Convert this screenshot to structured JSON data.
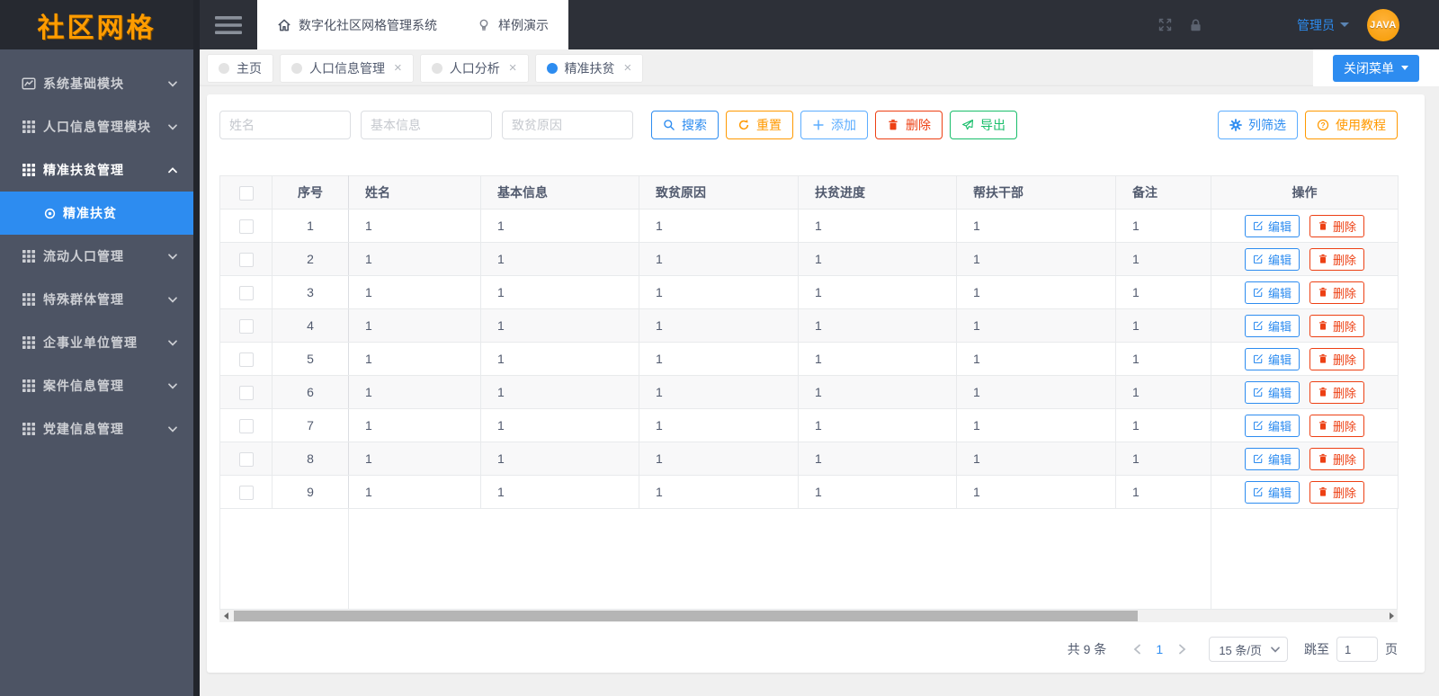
{
  "brand": {
    "logo_text": "社区网格"
  },
  "topbar": {
    "menu": [
      {
        "label": "数字化社区网格管理系统",
        "icon": "home-icon"
      },
      {
        "label": "样例演示",
        "icon": "bulb-icon"
      }
    ],
    "icons": [
      "fullscreen-icon",
      "lock-icon"
    ],
    "user_name": "管理员",
    "avatar_text": "JAVA"
  },
  "tabstrip": {
    "tabs": [
      {
        "label": "主页",
        "active": false,
        "closable": false
      },
      {
        "label": "人口信息管理",
        "active": false,
        "closable": true
      },
      {
        "label": "人口分析",
        "active": false,
        "closable": true
      },
      {
        "label": "精准扶贫",
        "active": true,
        "closable": true
      }
    ],
    "close_icon": "×",
    "close_menu_label": "关闭菜单"
  },
  "sidebar": {
    "items": [
      {
        "label": "系统基础模块",
        "icon": "chart-icon",
        "expanded": false
      },
      {
        "label": "人口信息管理模块",
        "icon": "grid-icon",
        "expanded": false
      },
      {
        "label": "精准扶贫管理",
        "icon": "grid-icon",
        "expanded": true,
        "children": [
          {
            "label": "精准扶贫",
            "icon": "target-icon",
            "active": true
          }
        ]
      },
      {
        "label": "流动人口管理",
        "icon": "grid-icon",
        "expanded": false
      },
      {
        "label": "特殊群体管理",
        "icon": "grid-icon",
        "expanded": false
      },
      {
        "label": "企事业单位管理",
        "icon": "grid-icon",
        "expanded": false
      },
      {
        "label": "案件信息管理",
        "icon": "grid-icon",
        "expanded": false
      },
      {
        "label": "党建信息管理",
        "icon": "grid-icon",
        "expanded": false
      }
    ]
  },
  "toolbar": {
    "filters": [
      {
        "placeholder": "姓名"
      },
      {
        "placeholder": "基本信息"
      },
      {
        "placeholder": "致贫原因"
      }
    ],
    "buttons": {
      "search": "搜索",
      "reset": "重置",
      "add": "添加",
      "delete": "删除",
      "export": "导出",
      "column_filter": "列筛选",
      "tutorial": "使用教程"
    }
  },
  "table": {
    "columns": [
      "序号",
      "姓名",
      "基本信息",
      "致贫原因",
      "扶贫进度",
      "帮扶干部",
      "备注",
      "操作"
    ],
    "rows": [
      {
        "index": "1",
        "values": [
          "1",
          "1",
          "1",
          "1",
          "1",
          "1"
        ]
      },
      {
        "index": "2",
        "values": [
          "1",
          "1",
          "1",
          "1",
          "1",
          "1"
        ]
      },
      {
        "index": "3",
        "values": [
          "1",
          "1",
          "1",
          "1",
          "1",
          "1"
        ]
      },
      {
        "index": "4",
        "values": [
          "1",
          "1",
          "1",
          "1",
          "1",
          "1"
        ]
      },
      {
        "index": "5",
        "values": [
          "1",
          "1",
          "1",
          "1",
          "1",
          "1"
        ]
      },
      {
        "index": "6",
        "values": [
          "1",
          "1",
          "1",
          "1",
          "1",
          "1"
        ]
      },
      {
        "index": "7",
        "values": [
          "1",
          "1",
          "1",
          "1",
          "1",
          "1"
        ]
      },
      {
        "index": "8",
        "values": [
          "1",
          "1",
          "1",
          "1",
          "1",
          "1"
        ]
      },
      {
        "index": "9",
        "values": [
          "1",
          "1",
          "1",
          "1",
          "1",
          "1"
        ]
      }
    ],
    "row_actions": {
      "edit": "编辑",
      "delete": "删除"
    }
  },
  "pagination": {
    "total_text": "共 9 条",
    "current_page": "1",
    "page_size_text": "15 条/页",
    "jump_label": "跳至",
    "jump_value": "1",
    "jump_suffix": "页"
  },
  "colors": {
    "primary": "#2d8cf0",
    "primary_light": "#5cadff",
    "warning": "#ff9900",
    "error": "#ed4014",
    "success": "#19be6b",
    "sidebar_bg": "#4d5464",
    "topbar_bg": "#2d3038",
    "logo_orange": "#ff9c00"
  }
}
